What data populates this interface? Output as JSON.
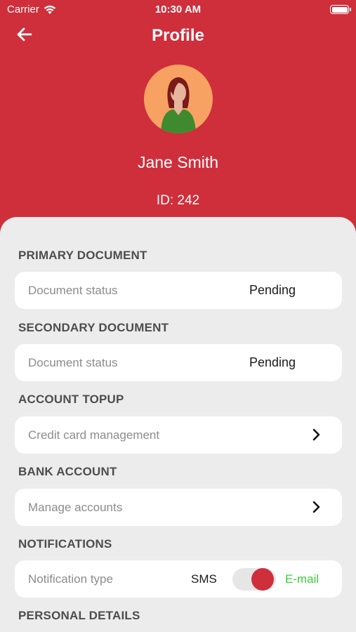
{
  "status_bar": {
    "carrier": "Carrier",
    "time": "10:30 AM"
  },
  "header": {
    "title": "Profile",
    "user_name": "Jane Smith",
    "user_id": "ID: 242",
    "accent_color": "#cf2e3b"
  },
  "sections": {
    "primary_document": {
      "title": "PRIMARY DOCUMENT",
      "row_label": "Document status",
      "row_value": "Pending"
    },
    "secondary_document": {
      "title": "SECONDARY DOCUMENT",
      "row_label": "Document status",
      "row_value": "Pending"
    },
    "account_topup": {
      "title": "ACCOUNT TOPUP",
      "row_label": "Credit card management",
      "icon": "chevron-right-icon"
    },
    "bank_account": {
      "title": "BANK ACCOUNT",
      "row_label": "Manage accounts",
      "icon": "chevron-right-icon"
    },
    "notifications": {
      "title": "NOTIFICATIONS",
      "row_label": "Notification type",
      "option_left": "SMS",
      "option_right": "E-mail",
      "selected": "E-mail",
      "selected_color": "#3ad03a"
    },
    "personal_details": {
      "title": "PERSONAL DETAILS"
    }
  }
}
